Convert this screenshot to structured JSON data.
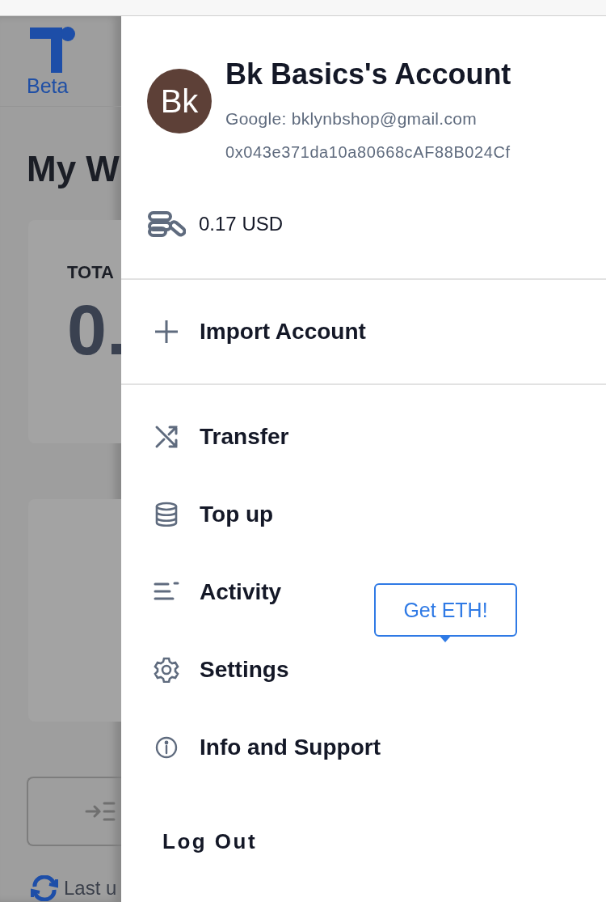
{
  "background": {
    "logo_label": "Beta",
    "title": "My W",
    "card_label": "TOTA",
    "card_value": "0.",
    "status": "Last u"
  },
  "account": {
    "avatar": "Bk",
    "title": "Bk Basics's Account",
    "login": "Google: bklynbshop@gmail.com",
    "address": "0x043e371da10a80668cAF88B024Cf",
    "balance": "0.17 USD"
  },
  "import_item": {
    "label": "Import Account"
  },
  "menu": [
    {
      "label": "Transfer"
    },
    {
      "label": "Top up"
    },
    {
      "label": "Activity"
    },
    {
      "label": "Settings"
    },
    {
      "label": "Info and Support"
    }
  ],
  "tooltip": {
    "label": "Get ETH!"
  },
  "logout": {
    "label": "Log Out"
  }
}
